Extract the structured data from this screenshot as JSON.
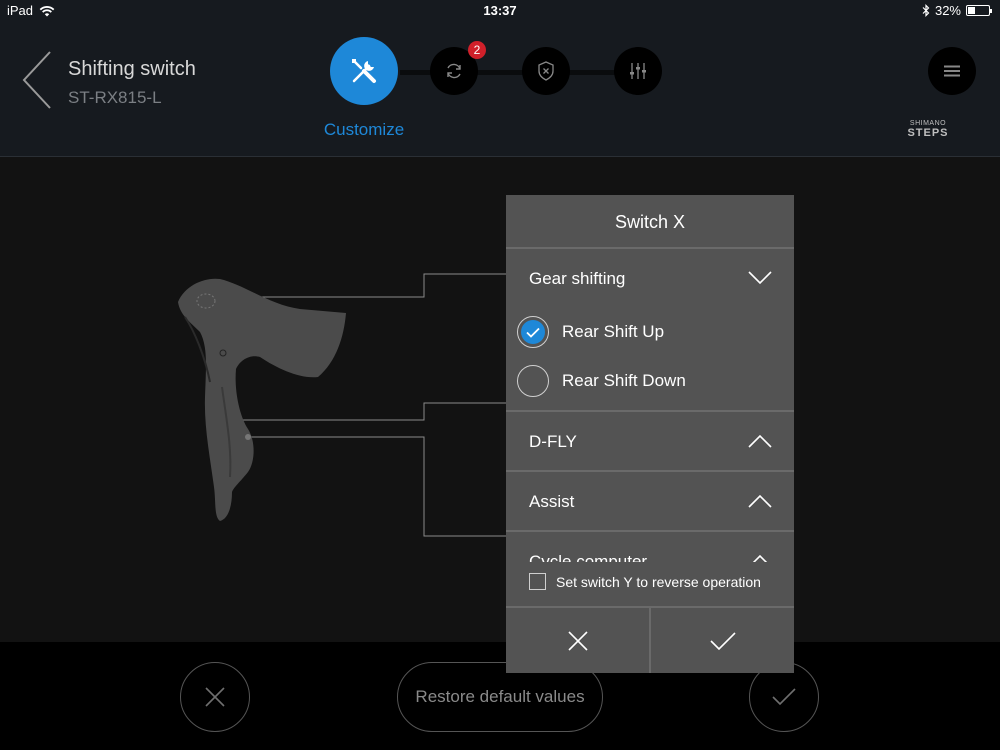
{
  "status_bar": {
    "device": "iPad",
    "time": "13:37",
    "battery": "32%",
    "battery_level": 0.32
  },
  "header": {
    "title": "Shifting switch",
    "subtitle": "ST-RX815-L",
    "active_step_label": "Customize",
    "update_badge_count": "2",
    "brand_top": "SHIMANO",
    "brand_bottom": "STEPS"
  },
  "dialog": {
    "title": "Switch X",
    "sections": [
      {
        "label": "Gear shifting",
        "expanded": true
      },
      {
        "label": "D-FLY",
        "expanded": false
      },
      {
        "label": "Assist",
        "expanded": false
      },
      {
        "label": "Cycle computer",
        "expanded": false
      }
    ],
    "options": [
      {
        "label": "Rear Shift Up",
        "selected": true
      },
      {
        "label": "Rear Shift Down",
        "selected": false
      }
    ],
    "reverse_label": "Set switch Y to reverse operation",
    "reverse_checked": false
  },
  "bottom_bar": {
    "restore_label": "Restore default values"
  },
  "colors": {
    "accent": "#1e88d8",
    "badge": "#d0202a",
    "dialog_bg": "#535353"
  }
}
